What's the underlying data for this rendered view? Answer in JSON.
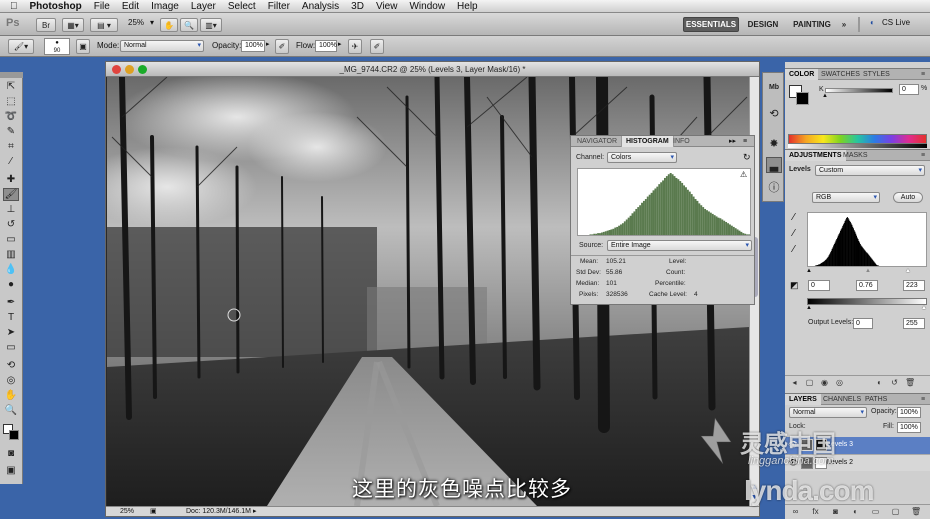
{
  "menubar": {
    "app_name": "Photoshop",
    "items": [
      "File",
      "Edit",
      "Image",
      "Layer",
      "Select",
      "Filter",
      "Analysis",
      "3D",
      "View",
      "Window",
      "Help"
    ]
  },
  "appbar": {
    "logo": "Ps",
    "zoom": "25%",
    "workspaces": [
      "ESSENTIALS",
      "DESIGN",
      "PAINTING"
    ],
    "more": "»",
    "cs_live": "CS Live"
  },
  "options": {
    "brush_size": "90",
    "mode_label": "Mode:",
    "mode_value": "Normal",
    "opacity_label": "Opacity:",
    "opacity_value": "100%",
    "flow_label": "Flow:",
    "flow_value": "100%"
  },
  "document": {
    "title": "_MG_9744.CR2 @ 25% (Levels 3, Layer Mask/16) *",
    "zoom": "25%",
    "doc_info": "Doc: 120.3M/146.1M"
  },
  "histogram": {
    "tabs": [
      "NAVIGATOR",
      "HISTOGRAM",
      "INFO"
    ],
    "channel_label": "Channel:",
    "channel_value": "Colors",
    "source_label": "Source:",
    "source_value": "Entire Image",
    "stats": {
      "mean_label": "Mean:",
      "mean": "105.21",
      "stddev_label": "Std Dev:",
      "stddev": "55.86",
      "median_label": "Median:",
      "median": "101",
      "pixels_label": "Pixels:",
      "pixels": "328536",
      "level_label": "Level:",
      "level": "",
      "count_label": "Count:",
      "count": "",
      "percentile_label": "Percentile:",
      "percentile": "",
      "cache_label": "Cache Level:",
      "cache": "4"
    },
    "bars": [
      0,
      0,
      0,
      0,
      0,
      0,
      1,
      1,
      2,
      2,
      3,
      3,
      4,
      5,
      6,
      7,
      8,
      9,
      10,
      12,
      13,
      15,
      17,
      19,
      22,
      25,
      28,
      31,
      35,
      38,
      42,
      45,
      48,
      52,
      55,
      58,
      62,
      65,
      68,
      72,
      75,
      78,
      82,
      85,
      88,
      92,
      95,
      98,
      100,
      98,
      95,
      92,
      90,
      87,
      84,
      80,
      77,
      73,
      70,
      66,
      62,
      58,
      55,
      51,
      48,
      45,
      42,
      40,
      38,
      36,
      34,
      32,
      30,
      28,
      27,
      25,
      23,
      21,
      19,
      17,
      15,
      13,
      11,
      9,
      7,
      5,
      3,
      2,
      1,
      1
    ]
  },
  "color_panel": {
    "tabs": [
      "COLOR",
      "SWATCHES",
      "STYLES"
    ],
    "k_label": "K",
    "k_value": "0",
    "percent": "%"
  },
  "adjustments_panel": {
    "tabs": [
      "ADJUSTMENTS",
      "MASKS"
    ],
    "title": "Levels",
    "preset_value": "Custom",
    "channel_value": "RGB",
    "auto_label": "Auto",
    "input_black": "0",
    "input_gray": "0.76",
    "input_white": "223",
    "output_label": "Output Levels:",
    "output_black": "0",
    "output_white": "255"
  },
  "layers_panel": {
    "tabs": [
      "LAYERS",
      "CHANNELS",
      "PATHS"
    ],
    "blend_value": "Normal",
    "opacity_label": "Opacity:",
    "opacity_value": "100%",
    "lock_label": "Lock:",
    "fill_label": "Fill:",
    "fill_value": "100%",
    "layers": [
      "Levels 3",
      "Levels 2"
    ]
  },
  "subtitle": "这里的灰色噪点比较多",
  "watermark": {
    "top": "灵感中国",
    "mid": "lingganchina.com",
    "bottom": "lynda.com"
  },
  "colors": {
    "desktop_blue": "#3a64a8",
    "panel_gray": "#d0d0d0",
    "histogram_green": "#5a7a4e",
    "accent_blue": "#2b56b0"
  }
}
